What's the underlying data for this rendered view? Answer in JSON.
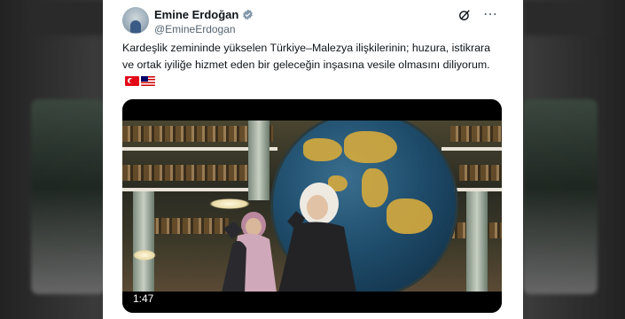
{
  "tweet": {
    "author_name": "Emine Erdoğan",
    "author_handle": "@EmineErdogan",
    "text": "Kardeşlik zemininde yükselen Türkiye–Malezya ilişkilerinin; huzura, istikrara ve ortak iyiliğe hizmet eden bir geleceğin inşasına vesile olmasını diliyorum.",
    "flags": [
      "turkey-flag",
      "malaysia-flag"
    ],
    "verified": true
  },
  "video": {
    "duration": "1:47"
  },
  "colors": {
    "text": "#0f1419",
    "secondary": "#536471",
    "verified": "#829aab"
  }
}
